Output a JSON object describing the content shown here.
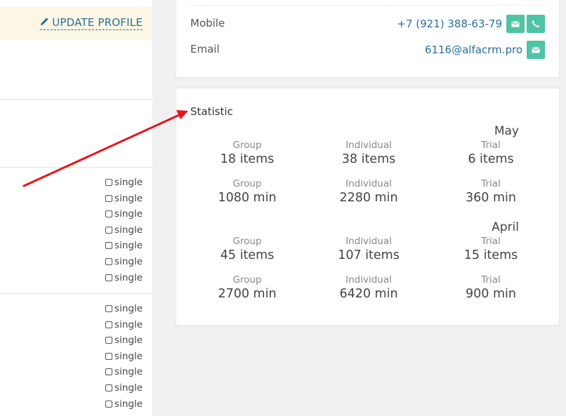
{
  "left_panel": {
    "update_profile_label": "UPDATE PROFILE",
    "single_groups": [
      [
        "single",
        "single",
        "single",
        "single",
        "single",
        "single",
        "single"
      ],
      [
        "single",
        "single",
        "single",
        "single",
        "single",
        "single",
        "single"
      ]
    ]
  },
  "contacts": [
    {
      "label": "Mobile",
      "value": "+7 (921) 388-63-79",
      "icons": [
        "mail-icon",
        "phone-icon"
      ]
    },
    {
      "label": "Email",
      "value": "6116@alfacrm.pro",
      "icons": [
        "mail-icon"
      ]
    }
  ],
  "statistic": {
    "title": "Statistic",
    "months": [
      {
        "name": "May",
        "rows": [
          [
            {
              "label": "Group",
              "value": "18 items"
            },
            {
              "label": "Individual",
              "value": "38 items"
            },
            {
              "label": "Trial",
              "value": "6 items"
            }
          ],
          [
            {
              "label": "Group",
              "value": "1080 min"
            },
            {
              "label": "Individual",
              "value": "2280 min"
            },
            {
              "label": "Trial",
              "value": "360 min"
            }
          ]
        ]
      },
      {
        "name": "April",
        "rows": [
          [
            {
              "label": "Group",
              "value": "45 items"
            },
            {
              "label": "Individual",
              "value": "107 items"
            },
            {
              "label": "Trial",
              "value": "15 items"
            }
          ],
          [
            {
              "label": "Group",
              "value": "2700 min"
            },
            {
              "label": "Individual",
              "value": "6420 min"
            },
            {
              "label": "Trial",
              "value": "900 min"
            }
          ]
        ]
      }
    ]
  },
  "colors": {
    "link": "#2a6f9a",
    "icon_button": "#4ec4a4",
    "arrow": "#e8141b",
    "update_bar": "#fcf6e4"
  }
}
